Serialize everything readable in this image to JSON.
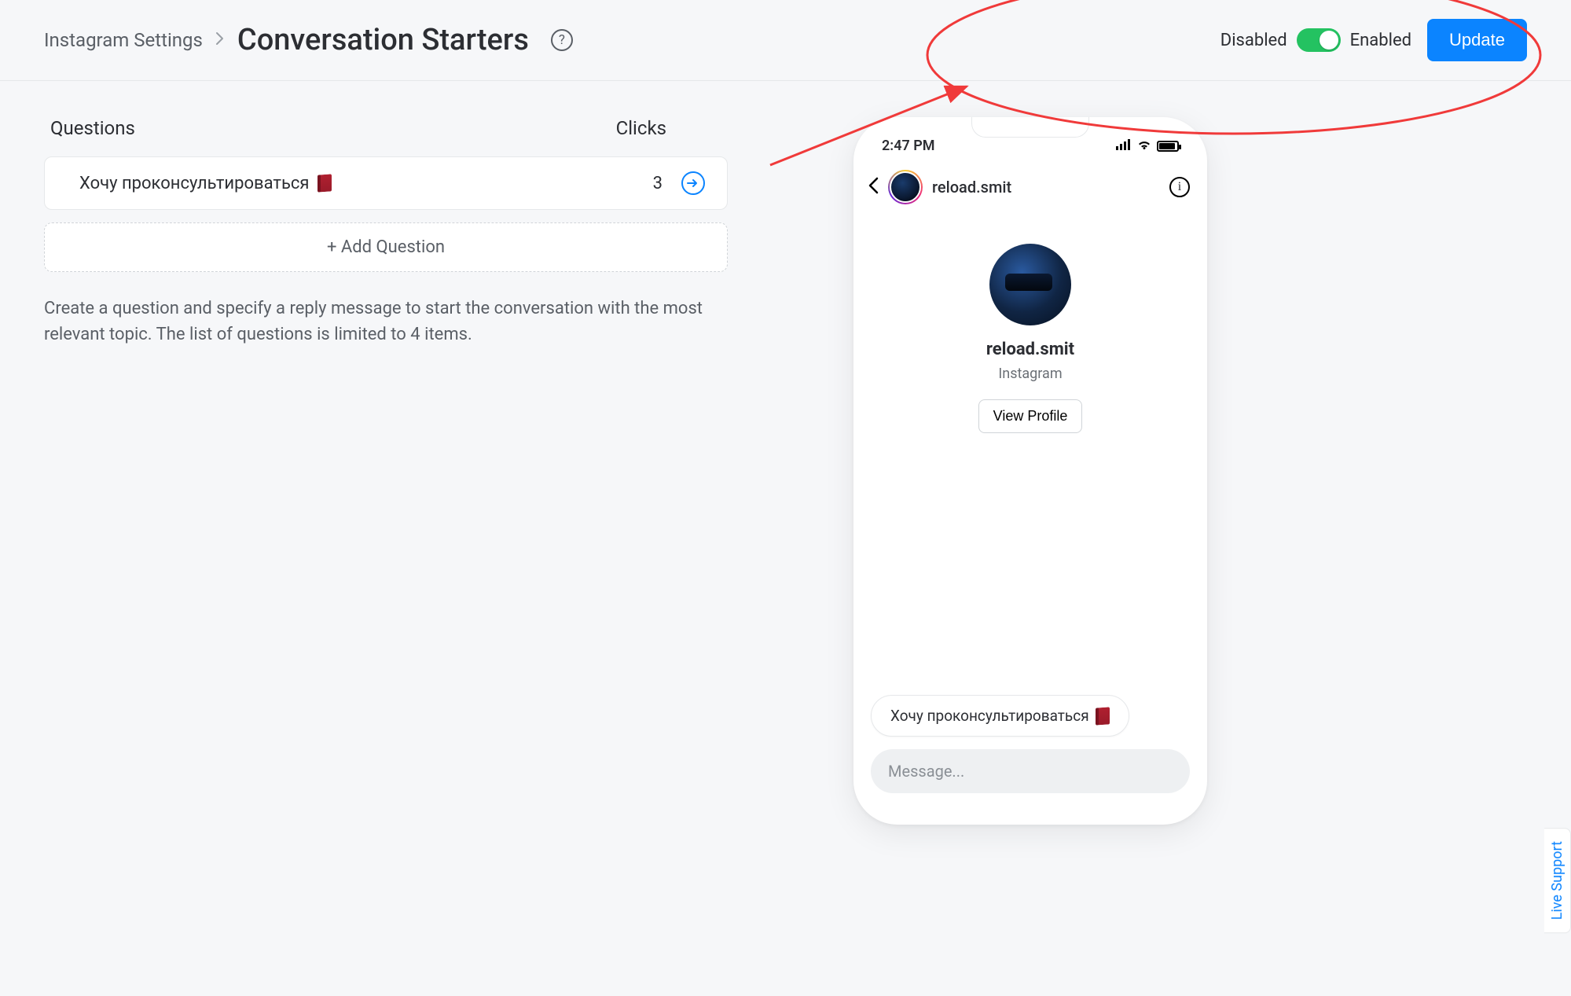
{
  "header": {
    "breadcrumb_parent": "Instagram Settings",
    "page_title": "Conversation Starters",
    "help_glyph": "?",
    "toggle_disabled_label": "Disabled",
    "toggle_enabled_label": "Enabled",
    "toggle_on": true,
    "update_label": "Update"
  },
  "table": {
    "col_questions": "Questions",
    "col_clicks": "Clicks",
    "rows": [
      {
        "text": "Хочу проконсультироваться",
        "clicks": "3"
      }
    ],
    "add_label": "+ Add Question",
    "help_text": "Create a question and specify a reply message to start the conversation with the most relevant topic. The list of questions is limited to 4 items."
  },
  "phone": {
    "time": "2:47 PM",
    "username": "reload.smit",
    "profile_name": "reload.smit",
    "profile_sub": "Instagram",
    "view_profile_label": "View Profile",
    "starter_chip": "Хочу проконсультироваться",
    "message_placeholder": "Message..."
  },
  "live_support_label": "Live Support",
  "colors": {
    "accent_blue": "#0b84ff",
    "toggle_green": "#24c261",
    "annotation_red": "#f03a3a"
  }
}
